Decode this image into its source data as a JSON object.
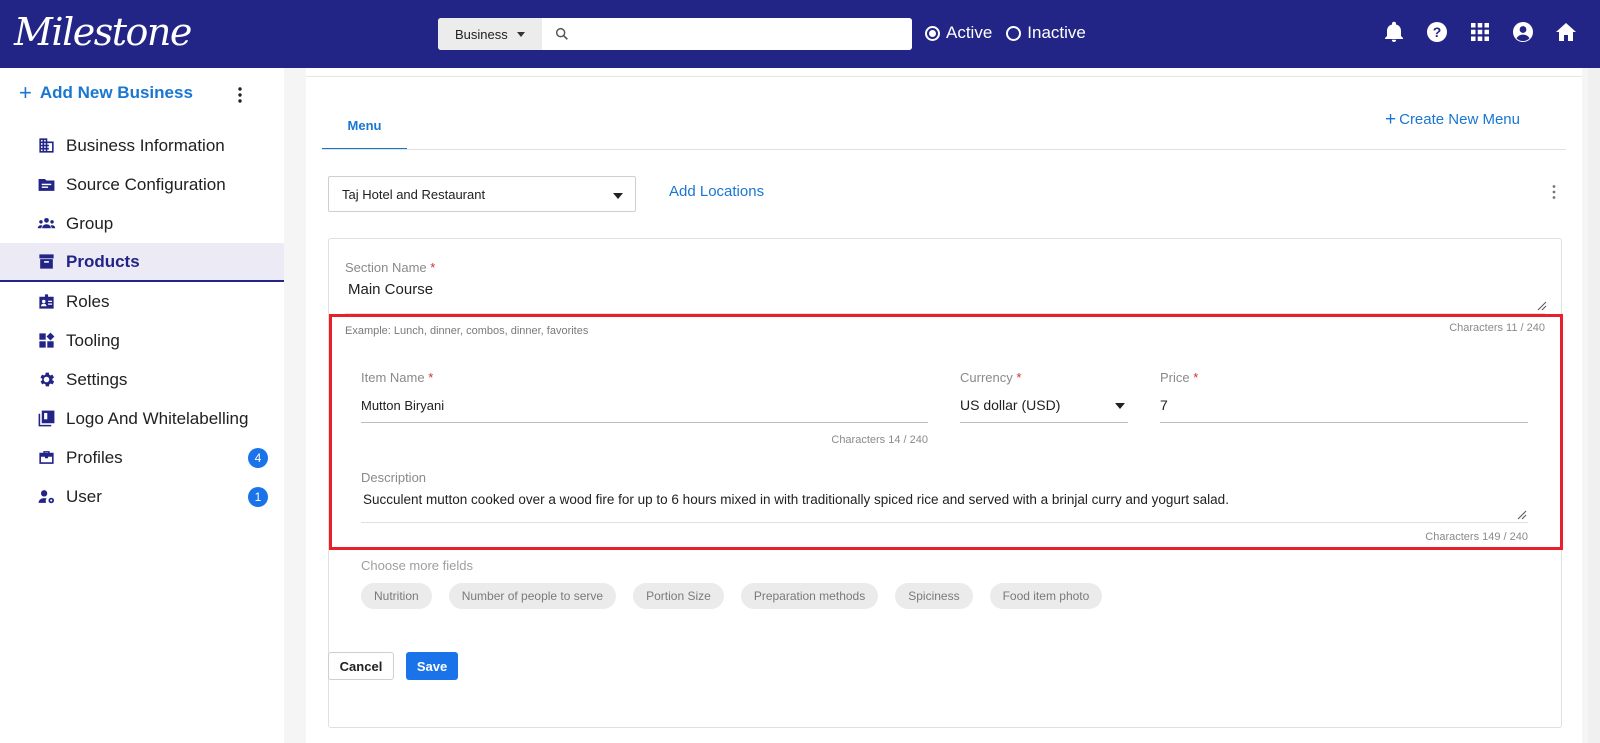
{
  "header": {
    "logo_text": "Milestone",
    "search": {
      "category": "Business",
      "placeholder": ""
    },
    "status_options": [
      {
        "label": "Active",
        "selected": true
      },
      {
        "label": "Inactive",
        "selected": false
      }
    ],
    "icons": [
      "bell-icon",
      "help-icon",
      "apps-grid-icon",
      "account-circle-icon",
      "home-icon"
    ],
    "bar_color": "#232586"
  },
  "sidebar": {
    "add_business_label": "Add New Business",
    "items": [
      {
        "label": "Business Information",
        "icon": "building-icon"
      },
      {
        "label": "Source Configuration",
        "icon": "folder-icon"
      },
      {
        "label": "Group",
        "icon": "group-icon"
      },
      {
        "label": "Products",
        "icon": "archive-box-icon",
        "active": true
      },
      {
        "label": "Roles",
        "icon": "id-badge-icon"
      },
      {
        "label": "Tooling",
        "icon": "dashboard-tiles-icon"
      },
      {
        "label": "Settings",
        "icon": "gear-icon"
      },
      {
        "label": "Logo And Whitelabelling",
        "icon": "library-books-icon"
      },
      {
        "label": "Profiles",
        "icon": "briefcase-icon",
        "badge": "4"
      },
      {
        "label": "User",
        "icon": "user-settings-icon",
        "badge": "1"
      }
    ]
  },
  "main": {
    "tab_label": "Menu",
    "create_menu_label": "Create New Menu",
    "location_select": "Taj Hotel and Restaurant",
    "add_locations_label": "Add Locations",
    "section": {
      "label": "Section Name",
      "value": "Main Course",
      "hint": "Example: Lunch, dinner, combos, dinner, favorites",
      "char_count": "Characters 11 / 240"
    },
    "item": {
      "name_label": "Item Name",
      "name_value": "Mutton Biryani",
      "name_char_count": "Characters 14 / 240",
      "currency_label": "Currency",
      "currency_value": "US dollar (USD)",
      "price_label": "Price",
      "price_value": "7",
      "description_label": "Description",
      "description_value": "Succulent mutton cooked over a wood fire for up to 6 hours mixed in with traditionally spiced rice and served with a brinjal curry and yogurt salad.",
      "description_char_count": "Characters 149 / 240"
    },
    "more_fields": {
      "label": "Choose more fields",
      "chips": [
        "Nutrition",
        "Number of people to serve",
        "Portion Size",
        "Preparation methods",
        "Spiciness",
        "Food item photo"
      ]
    },
    "buttons": {
      "cancel": "Cancel",
      "save": "Save"
    },
    "required_mark": "*",
    "highlight_color": "#e8202a",
    "accent_color": "#1a73e8"
  }
}
